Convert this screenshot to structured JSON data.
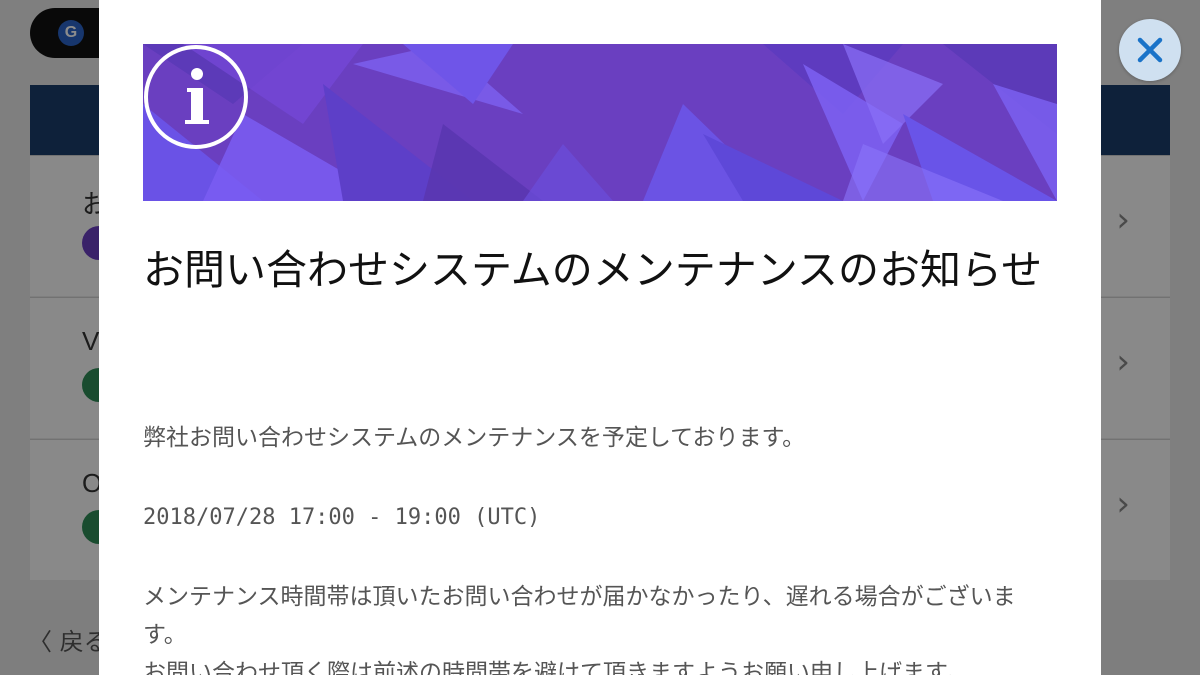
{
  "background_app": {
    "pill_icon_letter": "G",
    "rows": [
      {
        "label_start": "お",
        "dot_color": "#6a3fc0"
      },
      {
        "label_start": "V",
        "dot_color": "#2e8b57"
      },
      {
        "label_start": "O",
        "dot_color": "#2e8b57"
      }
    ],
    "back_label": "〈 戻る",
    "chevron": "›"
  },
  "modal": {
    "banner_icon": "info-icon",
    "title": "お問い合わせシステムのメンテナンスのお知らせ",
    "paragraphs": {
      "intro": "弊社お問い合わせシステムのメンテナンスを予定しております。",
      "schedule": "2018/07/28 17:00 - 19:00 (UTC)",
      "notice_line1": "メンテナンス時間帯は頂いたお問い合わせが届かなかったり、遅れる場合がございます。",
      "notice_line2": "お問い合わせ頂く際は前述の時間帯を避けて頂きますようお願い申し上げます。"
    }
  },
  "close_button": {
    "icon": "close-icon",
    "color": "#1a73c8"
  },
  "colors": {
    "banner": "#6a3fc0",
    "accent": "#1a73c8"
  }
}
